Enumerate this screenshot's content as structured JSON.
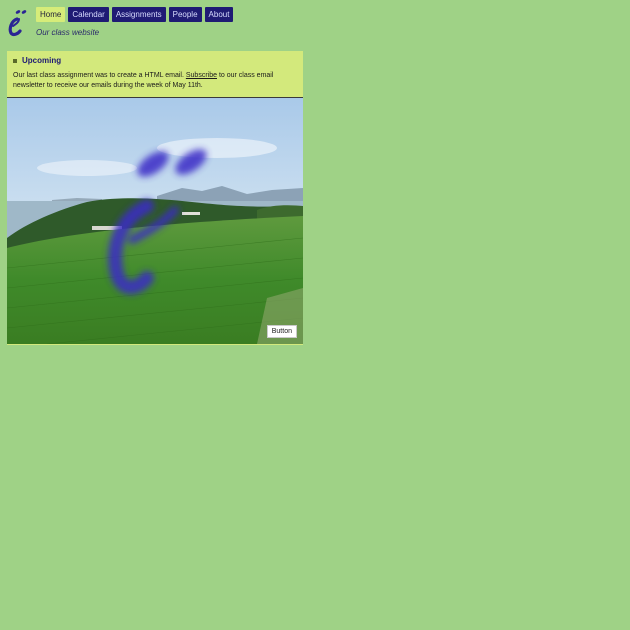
{
  "nav": {
    "items": [
      {
        "label": "Home",
        "active": true
      },
      {
        "label": "Calendar",
        "active": false
      },
      {
        "label": "Assignments",
        "active": false
      },
      {
        "label": "People",
        "active": false
      },
      {
        "label": "About",
        "active": false
      }
    ]
  },
  "header": {
    "tagline": "Our class website",
    "logo_icon": "accent-e-logo"
  },
  "card": {
    "title": "Upcoming",
    "text_before_link": "Our last class assignment was to create a HTML email. ",
    "link_text": "Subscribe",
    "text_after_link": " to our class email newsletter to receive our emails during the week of May 11th.",
    "photo_button": "Button",
    "photo_icon": "landscape-photo"
  },
  "colors": {
    "page_background": "#9fd286",
    "nav_background": "#1f1b74",
    "nav_active_background": "#d6ec79",
    "card_background": "#d3e97c",
    "logo_color": "#2a2494"
  }
}
